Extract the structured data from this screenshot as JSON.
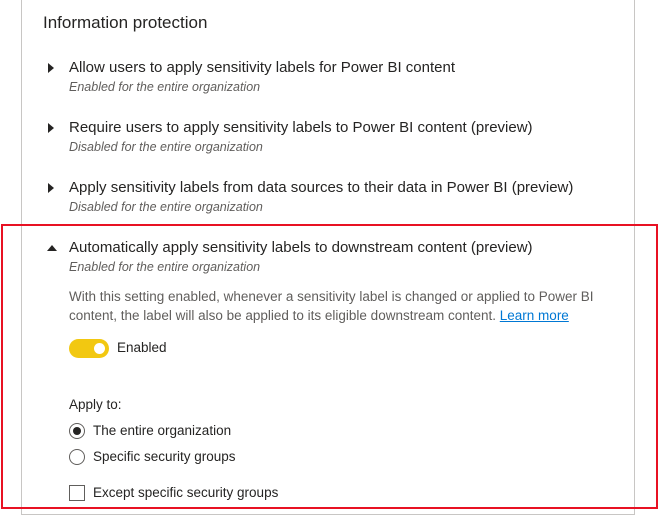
{
  "section": {
    "title": "Information protection"
  },
  "settings": [
    {
      "title": "Allow users to apply sensitivity labels for Power BI content",
      "status": "Enabled for the entire organization"
    },
    {
      "title": "Require users to apply sensitivity labels to Power BI content (preview)",
      "status": "Disabled for the entire organization"
    },
    {
      "title": "Apply sensitivity labels from data sources to their data in Power BI (preview)",
      "status": "Disabled for the entire organization"
    },
    {
      "title": "Automatically apply sensitivity labels to downstream content (preview)",
      "status": "Enabled for the entire organization"
    }
  ],
  "expanded": {
    "description": "With this setting enabled, whenever a sensitivity label is changed or applied to Power BI content, the label will also be applied to its eligible downstream content.",
    "learn_more": "Learn more",
    "toggle_label": "Enabled",
    "toggle_on": true,
    "apply_to_label": "Apply to:",
    "options": [
      {
        "label": "The entire organization",
        "selected": true
      },
      {
        "label": "Specific security groups",
        "selected": false
      }
    ],
    "except_label": "Except specific security groups",
    "except_checked": false
  },
  "colors": {
    "accent": "#f2c811",
    "link": "#0078d4",
    "highlight": "#e81123"
  }
}
